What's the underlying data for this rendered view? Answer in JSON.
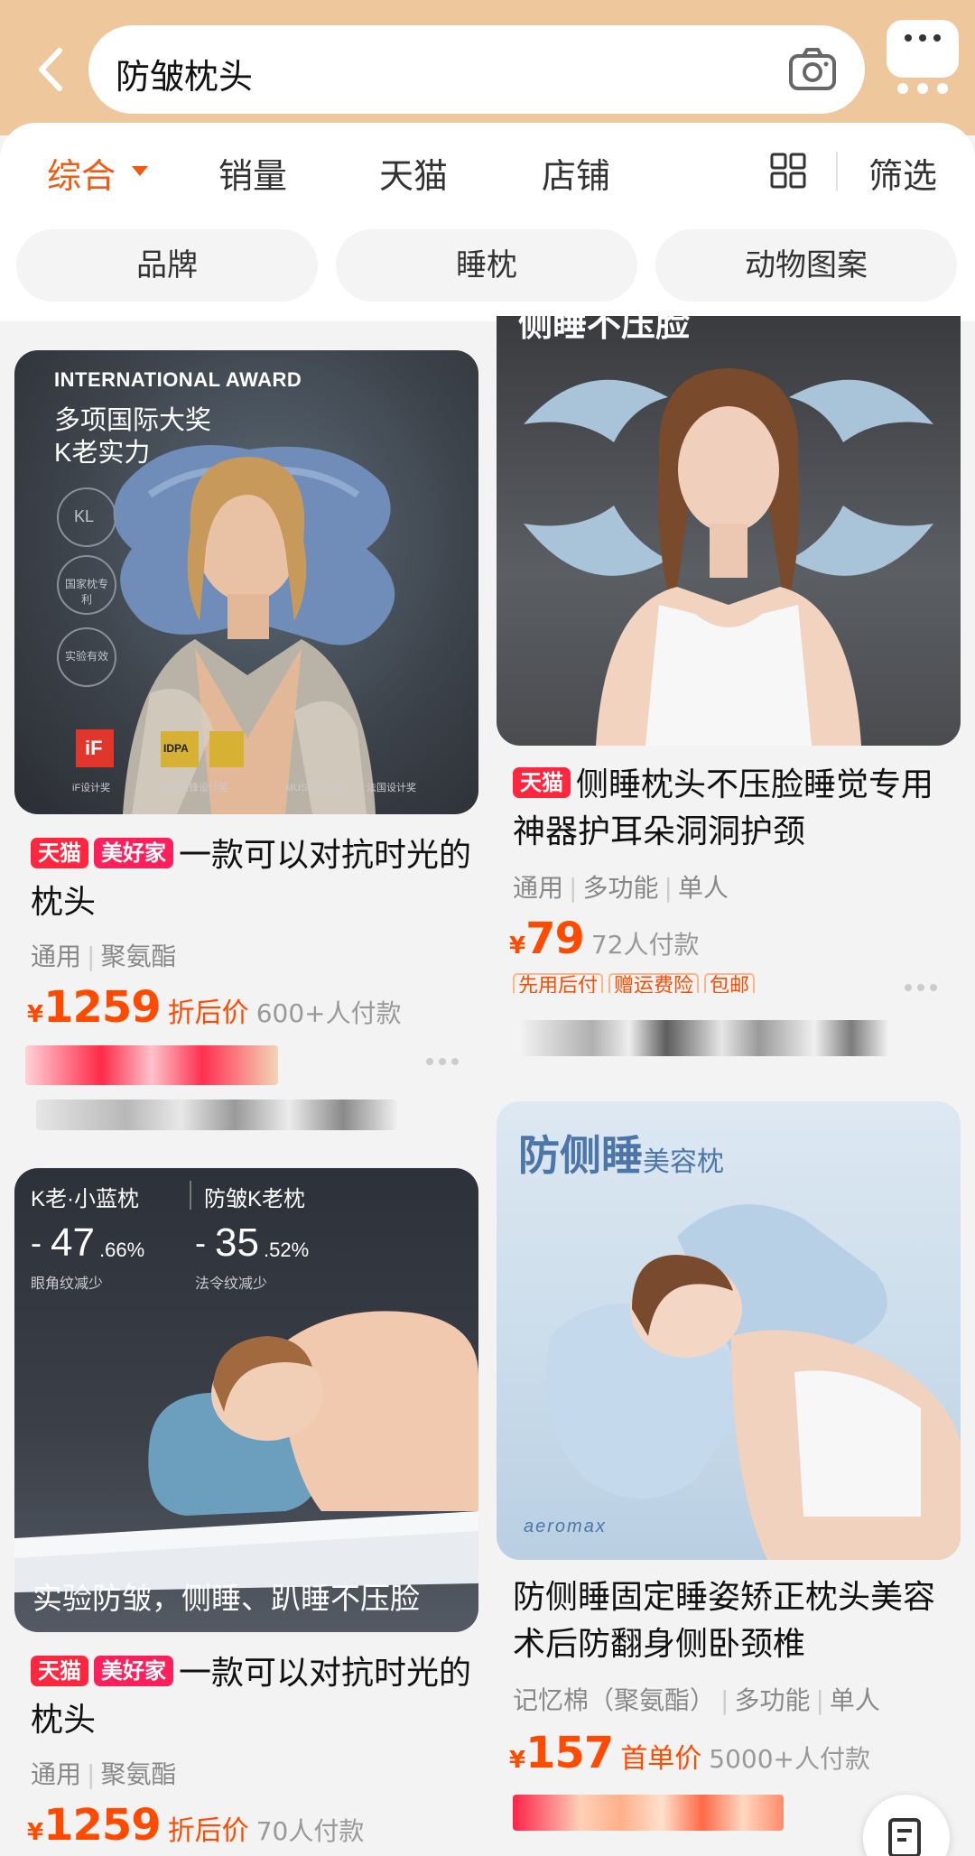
{
  "search": {
    "query": "防皱枕头"
  },
  "sort_tabs": [
    {
      "label": "综合",
      "active": true
    },
    {
      "label": "销量"
    },
    {
      "label": "天猫"
    },
    {
      "label": "店铺"
    }
  ],
  "filter_label": "筛选",
  "chips": [
    "品牌",
    "睡枕",
    "动物图案"
  ],
  "products": [
    {
      "badges": [
        "天猫",
        "美好家"
      ],
      "title": "一款可以对抗时光的枕头",
      "attrs": [
        "通用",
        "聚氨酯"
      ],
      "price": "1259",
      "price_tag": "折后价",
      "sold": "600+人付款",
      "image_text": {
        "award_en": "INTERNATIONAL AWARD",
        "line1": "多项国际大奖",
        "line2": "K老实力",
        "seal_kl": "KL",
        "seal_2": "国家枕专利",
        "seal_3": "实验有效",
        "logo_if": "iF",
        "logo_idpa": "IDPA",
        "award_labels": [
          "iF设计奖",
          "国际先锋设计奖",
          "MUSE设计奖",
          "法国设计奖"
        ]
      }
    },
    {
      "badges": [
        "天猫"
      ],
      "title": "侧睡枕头不压脸睡觉专用神器护耳朵洞洞护颈",
      "attrs": [
        "通用",
        "多功能",
        "单人"
      ],
      "price": "79",
      "sold": "72人付款",
      "services": [
        "先用后付",
        "赠运费险",
        "包邮"
      ],
      "image_text": {
        "headline": "侧睡不压脸"
      }
    },
    {
      "badges": [
        "天猫",
        "美好家"
      ],
      "title": "一款可以对抗时光的枕头",
      "attrs": [
        "通用",
        "聚氨酯"
      ],
      "price": "1259",
      "price_tag": "折后价",
      "sold": "70人付款",
      "image_text": {
        "brand": "K老·小蓝枕",
        "product": "防皱K老枕",
        "stat1_dash": "-",
        "stat1_value": "47",
        "stat1_unit": ".66%",
        "stat1_label": "眼角纹减少",
        "stat2_dash": "-",
        "stat2_value": "35",
        "stat2_unit": ".52%",
        "stat2_label": "法令纹减少",
        "caption": "实验防皱，侧睡、趴睡不压脸"
      }
    },
    {
      "badges": [],
      "title": "防侧睡固定睡姿矫正枕头美容术后防翻身侧卧颈椎",
      "attrs": [
        "记忆棉（聚氨酯）",
        "多功能",
        "单人"
      ],
      "price": "157",
      "price_tag": "首单价",
      "sold": "5000+人付款",
      "image_text": {
        "headline": "防侧睡",
        "sub": "美容枕",
        "brand": "aeromax"
      }
    }
  ],
  "colors": {
    "accent": "#f05a12",
    "price": "#ff4b00",
    "header_bg": "#efc79c",
    "badge": "#ff2740"
  },
  "icons": [
    "back-arrow-icon",
    "camera-icon",
    "more-dots-icon",
    "grid-view-icon",
    "caret-down-icon",
    "edit-icon"
  ]
}
